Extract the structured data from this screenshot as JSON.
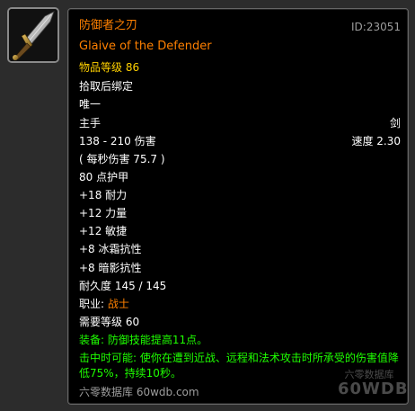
{
  "item": {
    "name_cn": "防御者之刃",
    "id_label": "ID:23051",
    "name_en": "Glaive of the Defender",
    "item_level": "物品等级 86",
    "bind": "拾取后绑定",
    "unique": "唯一",
    "slot": "主手",
    "type": "剑",
    "damage": "138 - 210 伤害",
    "speed": "速度 2.30",
    "dps": "( 每秒伤害 75.7 )",
    "armor": "80 点护甲",
    "stats": [
      "+18 耐力",
      "+12 力量",
      "+12 敏捷",
      "+8 冰霜抗性",
      "+8 暗影抗性"
    ],
    "durability": "耐久度 145 / 145",
    "class_label": "职业:",
    "class_value": "战士",
    "required_level": "需要等级 60",
    "equip_effect": "装备: 防御技能提高11点。",
    "chance_on_hit_line1": "击中时可能: 使你在遭到近战、远程和法术攻击时所承受的伤害值降",
    "chance_on_hit_line2": "低75%，持续10秒。",
    "source": "六零数据库 60wdb.com"
  },
  "watermark": {
    "cn": "六零数据库",
    "en": "60WDB"
  },
  "icon": "glaive-weapon-icon",
  "colors": {
    "legendary_orange": "#ff8000",
    "gold": "#ffd100",
    "green": "#1eff00",
    "grey": "#9d9d9d",
    "white": "#ffffff"
  }
}
